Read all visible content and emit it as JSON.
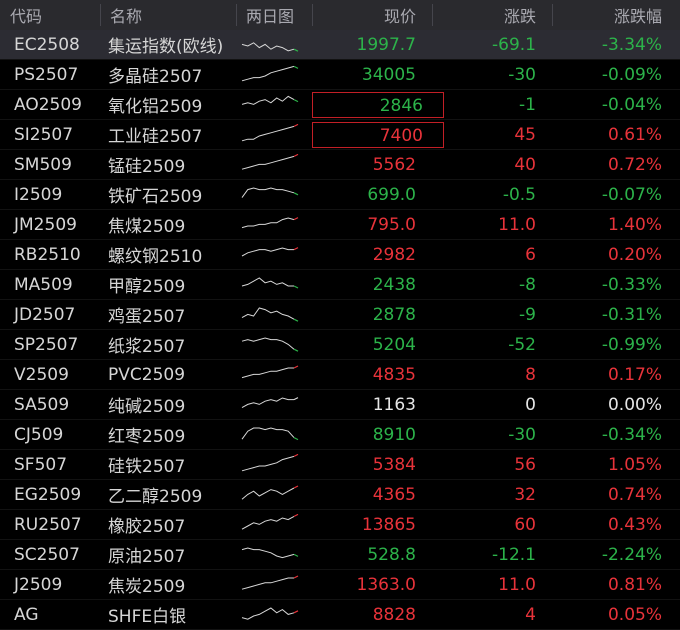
{
  "header": {
    "code": "代码",
    "name": "名称",
    "spark": "两日图",
    "price": "现价",
    "change": "涨跌",
    "pct": "涨跌幅"
  },
  "colors": {
    "up": "#e8333a",
    "down": "#2cb34a",
    "flat": "#e6e6e6",
    "spark": "#d8d8d8"
  },
  "rows": [
    {
      "code": "EC2508",
      "name": "集运指数(欧线)",
      "price": "1997.7",
      "change": "-69.1",
      "pct": "-3.34%",
      "dir": "down",
      "price_dir": "down",
      "selected": true,
      "boxed": false,
      "spark": [
        6,
        5,
        7,
        4,
        6,
        3,
        5,
        4,
        2,
        3
      ]
    },
    {
      "code": "PS2507",
      "name": "多晶硅2507",
      "price": "34005",
      "change": "-30",
      "pct": "-0.09%",
      "dir": "down",
      "price_dir": "down",
      "selected": false,
      "boxed": false,
      "spark": [
        2,
        3,
        4,
        4,
        5,
        7,
        8,
        9,
        10,
        11
      ]
    },
    {
      "code": "AO2509",
      "name": "氧化铝2509",
      "price": "2846",
      "change": "-1",
      "pct": "-0.04%",
      "dir": "down",
      "price_dir": "down",
      "selected": false,
      "boxed": true,
      "spark": [
        6,
        7,
        6,
        8,
        9,
        7,
        10,
        8,
        11,
        9
      ]
    },
    {
      "code": "SI2507",
      "name": "工业硅2507",
      "price": "7400",
      "change": "45",
      "pct": "0.61%",
      "dir": "up",
      "price_dir": "up",
      "selected": false,
      "boxed": true,
      "spark": [
        2,
        3,
        3,
        5,
        6,
        7,
        8,
        9,
        10,
        11
      ]
    },
    {
      "code": "SM509",
      "name": "锰硅2509",
      "price": "5562",
      "change": "40",
      "pct": "0.72%",
      "dir": "up",
      "price_dir": "up",
      "selected": false,
      "boxed": false,
      "spark": [
        3,
        4,
        5,
        6,
        6,
        7,
        8,
        9,
        10,
        11
      ]
    },
    {
      "code": "I2509",
      "name": "铁矿石2509",
      "price": "699.0",
      "change": "-0.5",
      "pct": "-0.07%",
      "dir": "down",
      "price_dir": "down",
      "selected": false,
      "boxed": false,
      "spark": [
        4,
        9,
        10,
        9,
        9,
        10,
        9,
        9,
        8,
        7
      ]
    },
    {
      "code": "JM2509",
      "name": "焦煤2509",
      "price": "795.0",
      "change": "11.0",
      "pct": "1.40%",
      "dir": "up",
      "price_dir": "up",
      "selected": false,
      "boxed": false,
      "spark": [
        4,
        5,
        5,
        6,
        6,
        7,
        7,
        9,
        10,
        9
      ]
    },
    {
      "code": "RB2510",
      "name": "螺纹钢2510",
      "price": "2982",
      "change": "6",
      "pct": "0.20%",
      "dir": "up",
      "price_dir": "up",
      "selected": false,
      "boxed": false,
      "spark": [
        5,
        7,
        8,
        9,
        9,
        8,
        9,
        10,
        9,
        9
      ]
    },
    {
      "code": "MA509",
      "name": "甲醇2509",
      "price": "2438",
      "change": "-8",
      "pct": "-0.33%",
      "dir": "down",
      "price_dir": "down",
      "selected": false,
      "boxed": false,
      "spark": [
        5,
        6,
        8,
        10,
        7,
        8,
        6,
        7,
        5,
        5
      ]
    },
    {
      "code": "JD2507",
      "name": "鸡蛋2507",
      "price": "2878",
      "change": "-9",
      "pct": "-0.31%",
      "dir": "down",
      "price_dir": "down",
      "selected": false,
      "boxed": false,
      "spark": [
        4,
        6,
        5,
        10,
        9,
        7,
        8,
        6,
        5,
        3
      ]
    },
    {
      "code": "SP2507",
      "name": "纸浆2507",
      "price": "5204",
      "change": "-52",
      "pct": "-0.99%",
      "dir": "down",
      "price_dir": "down",
      "selected": false,
      "boxed": false,
      "spark": [
        8,
        9,
        8,
        9,
        10,
        9,
        9,
        8,
        6,
        3
      ]
    },
    {
      "code": "V2509",
      "name": "PVC2509",
      "price": "4835",
      "change": "8",
      "pct": "0.17%",
      "dir": "up",
      "price_dir": "up",
      "selected": false,
      "boxed": false,
      "spark": [
        4,
        5,
        6,
        6,
        7,
        8,
        8,
        9,
        10,
        10
      ]
    },
    {
      "code": "SA509",
      "name": "纯碱2509",
      "price": "1163",
      "change": "0",
      "pct": "0.00%",
      "dir": "flat",
      "price_dir": "flat",
      "selected": false,
      "boxed": false,
      "spark": [
        4,
        6,
        7,
        6,
        8,
        9,
        8,
        10,
        9,
        9
      ]
    },
    {
      "code": "CJ509",
      "name": "红枣2509",
      "price": "8910",
      "change": "-30",
      "pct": "-0.34%",
      "dir": "down",
      "price_dir": "down",
      "selected": false,
      "boxed": false,
      "spark": [
        3,
        8,
        10,
        10,
        9,
        10,
        9,
        9,
        8,
        4
      ]
    },
    {
      "code": "SF507",
      "name": "硅铁2507",
      "price": "5384",
      "change": "56",
      "pct": "1.05%",
      "dir": "up",
      "price_dir": "up",
      "selected": false,
      "boxed": false,
      "spark": [
        2,
        3,
        4,
        5,
        5,
        6,
        7,
        9,
        10,
        11
      ]
    },
    {
      "code": "EG2509",
      "name": "乙二醇2509",
      "price": "4365",
      "change": "32",
      "pct": "0.74%",
      "dir": "up",
      "price_dir": "up",
      "selected": false,
      "boxed": false,
      "spark": [
        3,
        6,
        8,
        5,
        7,
        9,
        8,
        6,
        8,
        10
      ]
    },
    {
      "code": "RU2507",
      "name": "橡胶2507",
      "price": "13865",
      "change": "60",
      "pct": "0.43%",
      "dir": "up",
      "price_dir": "up",
      "selected": false,
      "boxed": false,
      "spark": [
        3,
        5,
        7,
        6,
        8,
        9,
        8,
        10,
        9,
        11
      ]
    },
    {
      "code": "SC2507",
      "name": "原油2507",
      "price": "528.8",
      "change": "-12.1",
      "pct": "-2.24%",
      "dir": "down",
      "price_dir": "down",
      "selected": false,
      "boxed": false,
      "spark": [
        9,
        10,
        9,
        9,
        8,
        7,
        5,
        4,
        5,
        6
      ]
    },
    {
      "code": "J2509",
      "name": "焦炭2509",
      "price": "1363.0",
      "change": "11.0",
      "pct": "0.81%",
      "dir": "up",
      "price_dir": "up",
      "selected": false,
      "boxed": false,
      "spark": [
        3,
        4,
        5,
        6,
        7,
        7,
        8,
        9,
        10,
        10
      ]
    },
    {
      "code": "AG",
      "name": "SHFE白银",
      "price": "8828",
      "change": "4",
      "pct": "0.05%",
      "dir": "up",
      "price_dir": "up",
      "selected": false,
      "boxed": false,
      "spark": [
        4,
        3,
        5,
        6,
        8,
        10,
        7,
        9,
        6,
        7
      ]
    }
  ]
}
